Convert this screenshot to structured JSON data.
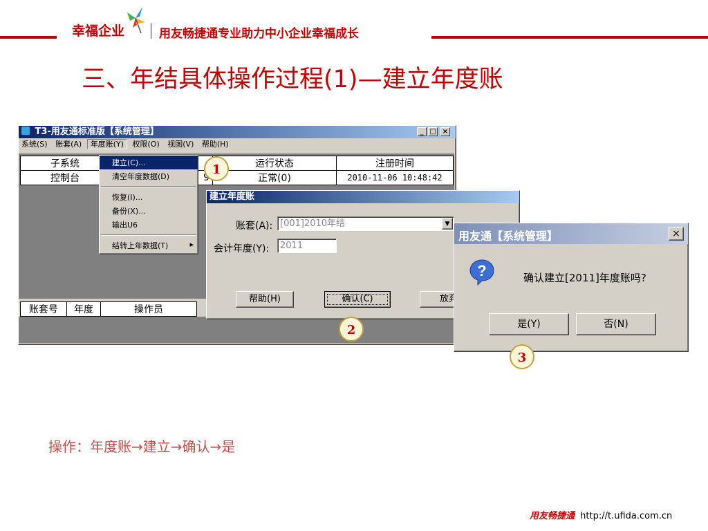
{
  "header": {
    "brand": "幸福企业",
    "tagline": "用友畅捷通专业助力中小企业幸福成长"
  },
  "slide_title": "三、年结具体操作过程(1)—建立年度账",
  "main_window": {
    "title": "T3-用友通标准版【系统管理】",
    "menus": [
      "系统(S)",
      "账套(A)",
      "年度账(Y)",
      "权限(O)",
      "视图(V)",
      "帮助(H)"
    ],
    "table_headers": [
      "子系统",
      "运行状态",
      "注册时间"
    ],
    "row": {
      "subsystem": "控制台",
      "partial": "9",
      "status": "正常(0)",
      "time": "2010-11-06 10:48:42"
    },
    "bottom_headers": [
      "账套号",
      "年度",
      "操作员"
    ]
  },
  "dropdown": {
    "items": [
      "建立(C)...",
      "清空年度数据(D)",
      "恢复(I)...",
      "备份(X)...",
      "输出U6",
      "结转上年数据(T)"
    ]
  },
  "create_dialog": {
    "title": "建立年度账",
    "account_label": "账套(A):",
    "account_value": "[001]2010年结",
    "year_label": "会计年度(Y):",
    "year_value": "2011",
    "help_btn": "帮助(H)",
    "ok_btn": "确认(C)",
    "cancel_btn": "放弃"
  },
  "confirm_dialog": {
    "title": "用友通【系统管理】",
    "message": "确认建立[2011]年度账吗?",
    "yes_btn": "是(Y)",
    "no_btn": "否(N)"
  },
  "steps": [
    "1",
    "2",
    "3"
  ],
  "operation_note": "操作：年度账→建立→确认→是",
  "footer": {
    "brand": "用友畅捷通",
    "url": "http://t.ufida.com.cn"
  },
  "colors": {
    "accent": "#c00000",
    "note": "#c0504d",
    "titlebar": "#0a246a"
  }
}
